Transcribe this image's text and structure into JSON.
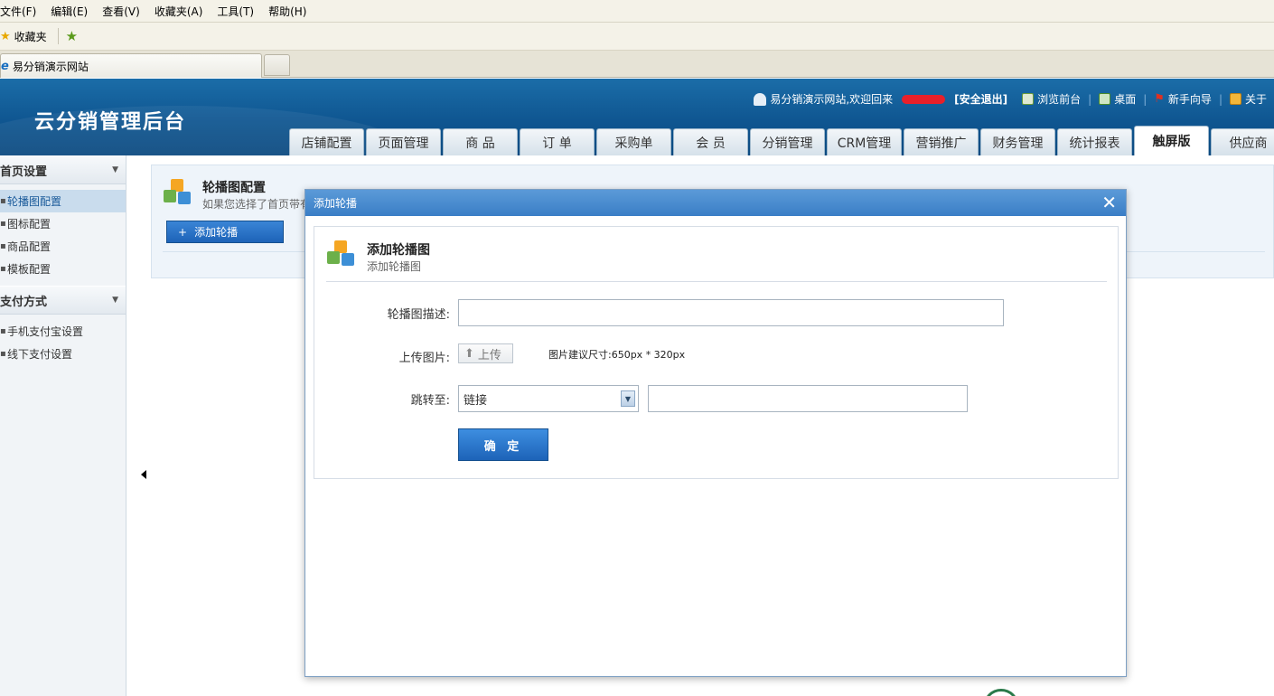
{
  "browser": {
    "menu": [
      "文件(F)",
      "编辑(E)",
      "查看(V)",
      "收藏夹(A)",
      "工具(T)",
      "帮助(H)"
    ],
    "favorites_label": "收藏夹",
    "tab_title": "易分销演示网站"
  },
  "header": {
    "logo": "云分销管理后台",
    "welcome": "易分销演示网站,欢迎回来",
    "logout": "[安全退出]",
    "links": [
      "浏览前台",
      "桌面",
      "新手向导",
      "关于"
    ],
    "sep": "|"
  },
  "nav": {
    "tabs": [
      {
        "label": "店铺配置",
        "active": false
      },
      {
        "label": "页面管理",
        "active": false
      },
      {
        "label": "商 品",
        "active": false
      },
      {
        "label": "订 单",
        "active": false
      },
      {
        "label": "采购单",
        "active": false
      },
      {
        "label": "会 员",
        "active": false
      },
      {
        "label": "分销管理",
        "active": false
      },
      {
        "label": "CRM管理",
        "active": false
      },
      {
        "label": "营销推广",
        "active": false
      },
      {
        "label": "财务管理",
        "active": false
      },
      {
        "label": "统计报表",
        "active": false
      },
      {
        "label": "触屏版",
        "active": true
      },
      {
        "label": "供应商",
        "active": false
      }
    ]
  },
  "sidebar": {
    "groups": [
      {
        "title": "首页设置",
        "items": [
          {
            "label": "轮播图配置",
            "active": true
          },
          {
            "label": "图标配置",
            "active": false
          },
          {
            "label": "商品配置",
            "active": false
          },
          {
            "label": "模板配置",
            "active": false
          }
        ]
      },
      {
        "title": "支付方式",
        "items": [
          {
            "label": "手机支付宝设置",
            "active": false
          },
          {
            "label": "线下支付设置",
            "active": false
          }
        ]
      }
    ]
  },
  "main": {
    "title": "轮播图配置",
    "desc": "如果您选择了首页带有",
    "add_button": "添加轮播"
  },
  "dialog": {
    "header": "添加轮播",
    "title": "添加轮播图",
    "subtitle": "添加轮播图",
    "desc_label": "轮播图描述:",
    "desc_value": "",
    "upload_label": "上传图片:",
    "upload_button": "上传",
    "size_hint": "图片建议尺寸:650px * 320px",
    "jump_label": "跳转至:",
    "jump_select": "链接",
    "jump_value": "",
    "ok": "确 定"
  }
}
